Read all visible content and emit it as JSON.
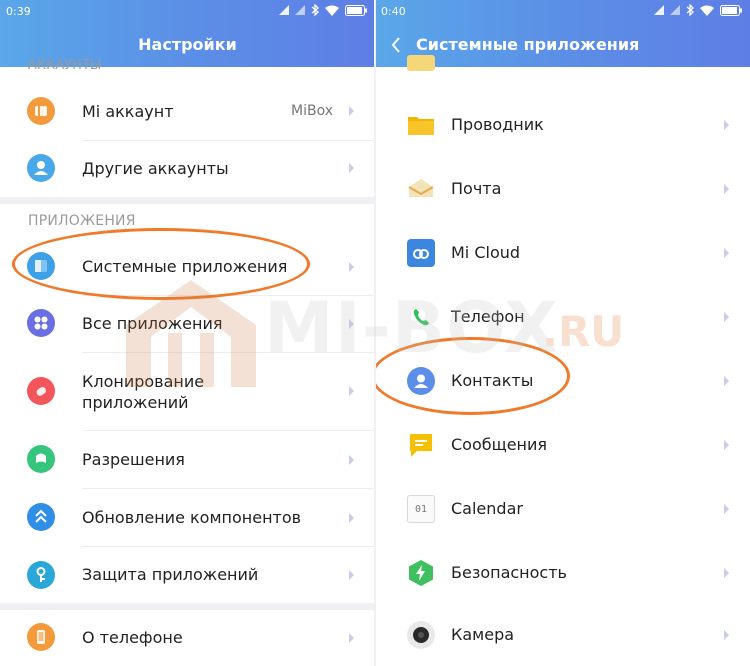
{
  "left": {
    "status": {
      "time": "0:39"
    },
    "header_title": "Настройки",
    "cut_section": "АККАУНТЫ",
    "accounts": [
      {
        "label": "Mi аккаунт",
        "value": "MiBox",
        "icon": "mi-account-icon",
        "color": "#f39a3c"
      },
      {
        "label": "Другие аккаунты",
        "icon": "user-icon",
        "color": "#4aa8e8"
      }
    ],
    "apps_section": "ПРИЛОЖЕНИЯ",
    "apps": [
      {
        "label": "Системные приложения",
        "icon": "system-apps-icon",
        "color": "#3ea1e8"
      },
      {
        "label": "Все приложения",
        "icon": "all-apps-icon",
        "color": "#6a6fe3"
      },
      {
        "label_line1": "Клонирование",
        "label_line2": "приложений",
        "icon": "clone-icon",
        "color": "#f2555a"
      },
      {
        "label": "Разрешения",
        "icon": "permissions-icon",
        "color": "#35c57d"
      },
      {
        "label": "Обновление компонентов",
        "icon": "update-icon",
        "color": "#2f8fe6"
      },
      {
        "label": "Защита приложений",
        "icon": "key-icon",
        "color": "#2ba6d8"
      }
    ],
    "about": {
      "label": "О телефоне",
      "icon": "phone-info-icon",
      "color": "#f39a3c"
    }
  },
  "right": {
    "status": {
      "time": "0:40"
    },
    "header_title": "Системные приложения",
    "items": [
      {
        "label": "Проводник",
        "icon": "folder-icon",
        "color": "#f5b400"
      },
      {
        "label": "Почта",
        "icon": "mail-icon",
        "color": "#e8c06a"
      },
      {
        "label": "Mi Cloud",
        "icon": "cloud-icon",
        "color": "#3d86e0"
      },
      {
        "label": "Телефон",
        "icon": "phone-icon",
        "color": "#2fbf5a"
      },
      {
        "label": "Контакты",
        "icon": "contacts-icon",
        "color": "#5a8ee8"
      },
      {
        "label": "Сообщения",
        "icon": "messages-icon",
        "color": "#f5c000"
      },
      {
        "label": "Calendar",
        "icon": "calendar-icon",
        "icon_text": "01",
        "color": "#9a9a9a"
      },
      {
        "label": "Безопасность",
        "icon": "security-icon",
        "color": "#3fbf5f"
      },
      {
        "label": "Камера",
        "icon": "camera-icon",
        "color": "#333333"
      }
    ]
  },
  "watermark": {
    "text": "MI-BOX",
    "suffix": ".RU",
    "accent": "#e2702b"
  },
  "colors": {
    "header_start": "#5aa7e9",
    "header_end": "#5e7ee6",
    "annotation": "#f07a2a"
  }
}
